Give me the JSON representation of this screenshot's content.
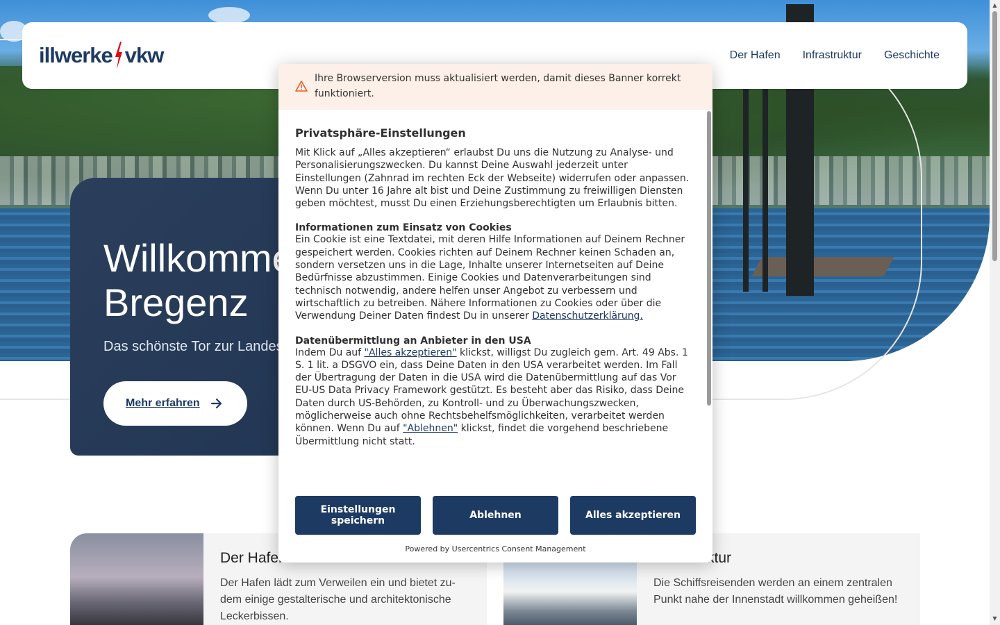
{
  "header": {
    "logo_left": "illwerke",
    "logo_right": "vkw",
    "nav": [
      {
        "label": "Der Hafen"
      },
      {
        "label": "Infrastruktur"
      },
      {
        "label": "Geschichte"
      }
    ]
  },
  "hero": {
    "title_line1": "Willkommen",
    "title_line2": "Bregenz",
    "subtitle": "Das schönste Tor zur Landeshauptstadt",
    "cta_label": "Mehr erfahren"
  },
  "features": [
    {
      "title": "Der Hafen",
      "text": "Der Hafen lädt zum Verweilen ein und bietet zu-dem einige gestalterische und architektonische Leckerbissen."
    },
    {
      "title": "Infrastruktur",
      "text": "Die Schiffsreisenden werden an einem zentralen Punkt nahe der Innenstadt willkommen geheißen!"
    }
  ],
  "consent": {
    "warning": "Ihre Browserversion muss aktualisiert werden, damit dieses Banner korrekt funktioniert.",
    "title": "Privatsphäre-Einstellungen",
    "intro": "Mit Klick auf „Alles akzeptieren“ erlaubst Du uns die Nutzung zu Analyse- und Personalisierungszwecken. Du kannst Deine Auswahl jederzeit unter Einstellungen (Zahnrad im rechten Eck der Webseite) widerrufen oder anpassen. Wenn Du unter 16 Jahre alt bist und Deine Zustimmung zu freiwilligen Diensten geben möchtest, musst Du einen Erziehungsberechtigten um Erlaubnis bitten.",
    "cookies_heading": "Informationen zum Einsatz von Cookies",
    "cookies_text": "Ein Cookie ist eine Textdatei, mit deren Hilfe Informationen auf Deinem Rechner gespeichert werden. Cookies richten auf Deinem Rechner keinen Schaden an, sondern versetzen uns in die Lage, Inhalte unserer Internetseiten auf Deine Bedürfnisse abzustimmen. Einige Cookies und Datenverarbeitungen sind technisch notwendig, andere helfen unser Angebot zu verbessern und wirtschaftlich zu betreiben. Nähere Informationen zu Cookies oder über die Verwendung Deiner Daten findest Du in unserer",
    "privacy_link": "Datenschutzerklärung.",
    "usa_heading": "Datenübermittlung an Anbieter in den USA",
    "usa_text_1": "Indem Du auf",
    "usa_link_accept": "\"Alles akzeptieren\"",
    "usa_text_2": "klickst, willigst Du zugleich gem. Art. 49 Abs. 1 S. 1 lit. a DSGVO ein, dass Deine Daten in den USA verarbeitet werden. Im Fall der Übertragung der Daten in die USA wird die Datenübermittlung auf das Vor EU-US Data Privacy Framework gestützt. Es besteht aber das Risiko, dass Deine Daten durch US-Behörden, zu Kontroll- und zu Überwachungszwecken, möglicherweise auch ohne Rechtsbehelfsmöglichkeiten, verarbeitet werden können. Wenn Du auf",
    "usa_link_decline": "\"Ablehnen\"",
    "usa_text_3": "klickst, findet die vorgehend beschriebene Übermittlung nicht statt.",
    "btn_save": "Einstellungen speichern",
    "btn_decline": "Ablehnen",
    "btn_accept": "Alles akzeptieren",
    "powered_by": "Powered by Usercentrics Consent Management"
  },
  "colors": {
    "brand_navy": "#1d3a63",
    "logo_red": "#e30613",
    "warning_bg": "#fdf0e8",
    "warning_icon": "#e0601d"
  }
}
